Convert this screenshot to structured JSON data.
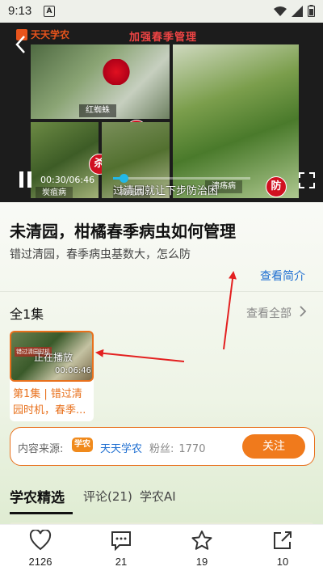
{
  "status_bar": {
    "time": "9:13",
    "notification_letter": "A"
  },
  "video": {
    "logo_text": "天天学农",
    "banner_title": "加强春季管理",
    "panels": [
      {
        "label": "红蜘蛛",
        "badge": "杀"
      },
      {
        "label": "",
        "badge": "防"
      },
      {
        "label": "炭疽病",
        "badge": "杀"
      },
      {
        "label": "褐斑病",
        "badge": ""
      }
    ],
    "blurred_label": "溃疡病",
    "current_time": "00:30",
    "total_time": "06:46",
    "progress": 0.074,
    "subtitle": "过清园就让下步防治困"
  },
  "title": "未清园，柑橘春季病虫如何管理",
  "subtitle": "错过清园，春季病虫基数大，怎么防",
  "intro_link": "查看简介",
  "episodes": {
    "header": "全1集",
    "see_all": "查看全部",
    "items": [
      {
        "label": "第1集 | 错过清园时机，春季...",
        "playing": "正在播放",
        "duration": "00:06:46",
        "thumb_caption": "错过清园时机"
      }
    ]
  },
  "source": {
    "label": "内容来源:",
    "logo_text": "学农",
    "name": "天天学农",
    "fans_label": "粉丝:",
    "fans": "1770",
    "follow": "关注"
  },
  "tabs": [
    {
      "label": "学农精选",
      "active": true
    },
    {
      "label": "评论(21)",
      "active": false
    },
    {
      "label": "学农AI",
      "active": false
    }
  ],
  "actions": [
    {
      "icon": "heart-icon",
      "count": "2126"
    },
    {
      "icon": "comment-icon",
      "count": "21"
    },
    {
      "icon": "star-icon",
      "count": "19"
    },
    {
      "icon": "share-icon",
      "count": "10"
    }
  ],
  "colors": {
    "accent": "#f07a1c",
    "link": "#1f6fd1",
    "progress": "#23b8e8",
    "annotation": "#e32020"
  }
}
